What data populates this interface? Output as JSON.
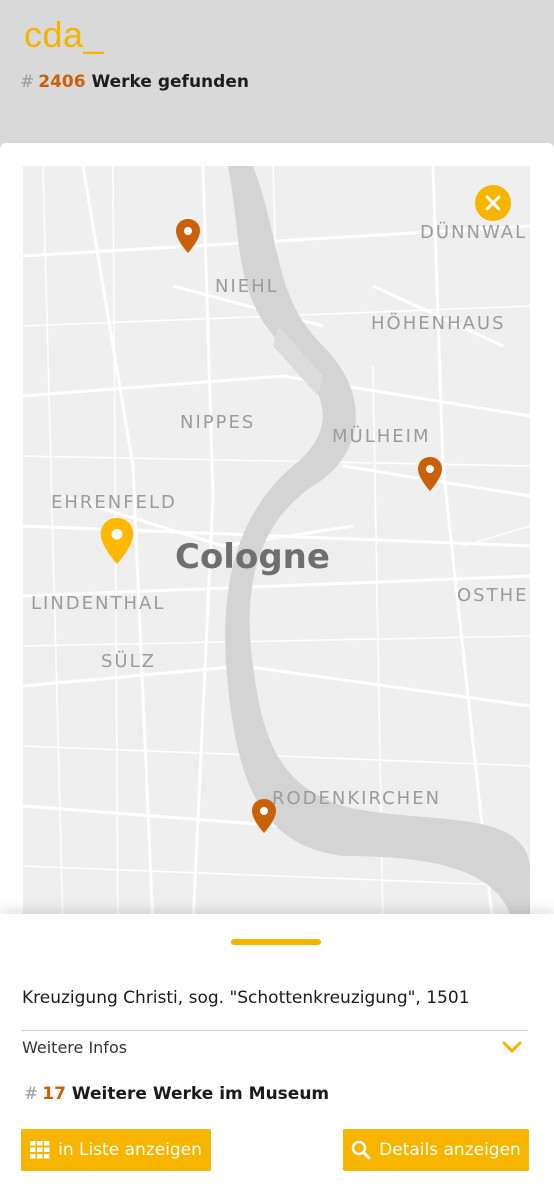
{
  "header": {
    "logo": "cda_",
    "hash": "#",
    "count": "2406",
    "count_label": "Werke gefunden"
  },
  "map": {
    "labels": {
      "dunnwald": "DÜNNWAL",
      "niehl": "NIEHL",
      "hohenhaus": "HÖHENHAUS",
      "nippes": "NIPPES",
      "mulheim": "MÜLHEIM",
      "ehrenfeld": "EHRENFELD",
      "city": "Cologne",
      "lindenthal": "LINDENTHAL",
      "osthe": "OSTHE",
      "sulz": "SÜLZ",
      "rodenkirchen": "RODENKIRCHEN"
    },
    "pin_color_active": "#ffb800",
    "pin_color_default": "#c8610a"
  },
  "sheet": {
    "title": "Kreuzigung Christi, sog. \"Schottenkreuzigung\", 1501",
    "infos_label": "Weitere Infos",
    "more_hash": "#",
    "more_count": "17",
    "more_label": "Weitere Werke im Museum",
    "btn_list": "in Liste anzeigen",
    "btn_details": "Details anzeigen"
  },
  "colors": {
    "accent": "#f7b500",
    "orange": "#c8610a",
    "header_bg": "#d9d9d9"
  }
}
